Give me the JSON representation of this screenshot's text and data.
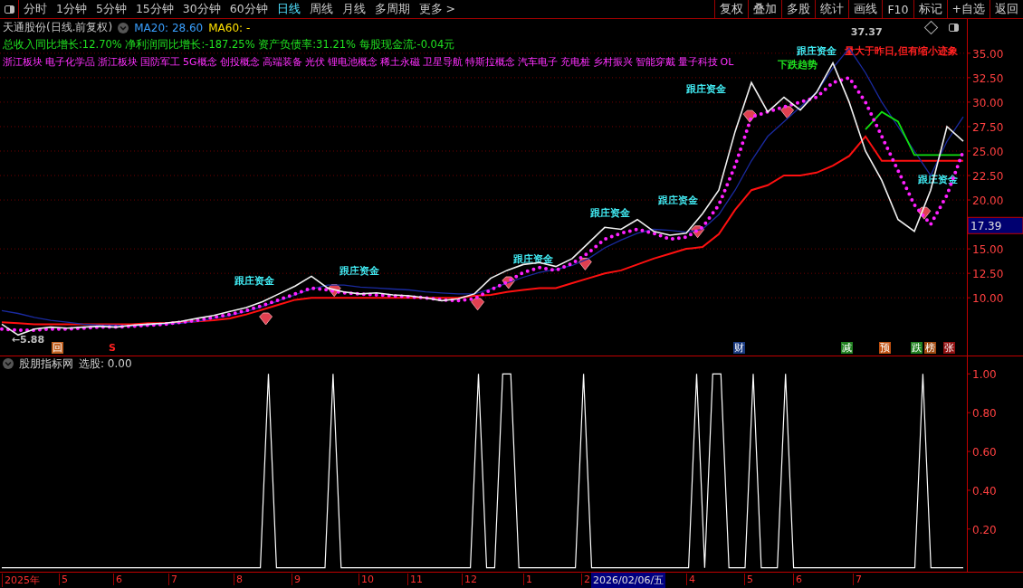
{
  "toolbar": {
    "periods": [
      {
        "label": "分时",
        "selected": false
      },
      {
        "label": "1分钟",
        "selected": false
      },
      {
        "label": "5分钟",
        "selected": false
      },
      {
        "label": "15分钟",
        "selected": false
      },
      {
        "label": "30分钟",
        "selected": false
      },
      {
        "label": "60分钟",
        "selected": false
      },
      {
        "label": "日线",
        "selected": true
      },
      {
        "label": "周线",
        "selected": false
      },
      {
        "label": "月线",
        "selected": false
      },
      {
        "label": "多周期",
        "selected": false
      },
      {
        "label": "更多 >",
        "selected": false
      }
    ],
    "buttons": [
      "复权",
      "叠加",
      "多股",
      "统计",
      "画线",
      "F10",
      "标记",
      "+自选",
      "返回"
    ]
  },
  "legend": {
    "title": "天通股份(日线.前复权)",
    "items": [
      {
        "text": "MA20: 28.60",
        "color": "#3aa0ff"
      },
      {
        "text": "MA60: -",
        "color": "#ffe000"
      }
    ]
  },
  "fundamentals": "总收入同比增长:12.70% 净利润同比增长:-187.25% 资产负债率:31.21% 每股现金流:-0.04元",
  "concepts": [
    "浙江板块",
    "电子化学品",
    "浙江板块",
    "国防军工",
    "5G概念",
    "创投概念",
    "高端装备",
    "光伏",
    "锂电池概念",
    "稀土永磁",
    "卫星导航",
    "特斯拉概念",
    "汽车电子",
    "充电桩",
    "乡村振兴",
    "智能穿戴",
    "量子科技",
    "OL"
  ],
  "main_chart": {
    "chart_data": {
      "type": "line",
      "grid": true,
      "categories": [
        null,
        null,
        null,
        null,
        null,
        null,
        null,
        null,
        null,
        null,
        null,
        null,
        null,
        null,
        null,
        null,
        null,
        null,
        null,
        null,
        null,
        null,
        null,
        null,
        null,
        null,
        null,
        null,
        null,
        null,
        null,
        null,
        null,
        null,
        null,
        null,
        null,
        null,
        null,
        null,
        null,
        null,
        null,
        null,
        null,
        null,
        null,
        null,
        null,
        null,
        null,
        null,
        null,
        null,
        null,
        null,
        null,
        null,
        null,
        null
      ],
      "ylim": [
        4.1,
        38.5
      ],
      "yticks": [
        {
          "value": 10,
          "label": "10.00"
        },
        {
          "value": 12.5,
          "label": "12.50"
        },
        {
          "value": 15,
          "label": "15.00"
        },
        {
          "value": 20,
          "label": "20.00"
        },
        {
          "value": 22.5,
          "label": "22.50"
        },
        {
          "value": 25,
          "label": "25.00"
        },
        {
          "value": 27.5,
          "label": "27.50"
        },
        {
          "value": 30,
          "label": "30.00"
        },
        {
          "value": 32.5,
          "label": "32.50"
        },
        {
          "value": 35,
          "label": "35.00"
        }
      ],
      "series": [
        {
          "color": "#ff1010",
          "values": [
            7.5,
            7.4,
            7.3,
            7.3,
            7.3,
            7.3,
            7.3,
            7.3,
            7.3,
            7.4,
            7.4,
            7.5,
            7.6,
            7.7,
            7.9,
            8.3,
            8.8,
            9.3,
            9.8,
            10.0,
            10.0,
            10.0,
            10.0,
            10.0,
            10.0,
            10.0,
            10.0,
            10.0,
            10.0,
            10.2,
            10.3,
            10.6,
            10.8,
            11.0,
            11.0,
            11.5,
            12.0,
            12.5,
            12.8,
            13.4,
            14.0,
            14.5,
            15.0,
            15.2,
            16.5,
            19.0,
            21.0,
            21.5,
            22.5,
            22.5,
            22.8,
            23.5,
            24.5,
            26.5,
            24.0,
            24.0,
            24.0,
            24.0,
            24.0,
            24.0
          ]
        },
        {
          "color": "#1a2aa0",
          "values": [
            8.7,
            8.4,
            8.0,
            7.7,
            7.5,
            7.3,
            7.2,
            7.2,
            7.1,
            7.2,
            7.3,
            7.4,
            7.6,
            7.9,
            8.2,
            8.6,
            9.1,
            9.7,
            10.3,
            10.9,
            11.3,
            11.3,
            11.1,
            11.0,
            10.9,
            10.8,
            10.6,
            10.5,
            10.4,
            10.4,
            10.9,
            11.5,
            12.1,
            12.6,
            12.9,
            13.3,
            14.0,
            15.1,
            15.9,
            16.6,
            17.0,
            16.9,
            16.7,
            17.0,
            18.5,
            21.0,
            24.0,
            26.5,
            28.0,
            29.5,
            31.0,
            33.5,
            35.5,
            33.0,
            30.0,
            27.5,
            25.0,
            22.5,
            26.0,
            28.5
          ]
        },
        {
          "color": "#10e010",
          "values": [
            null,
            null,
            null,
            null,
            null,
            null,
            null,
            null,
            null,
            null,
            null,
            null,
            null,
            null,
            null,
            null,
            null,
            null,
            null,
            null,
            null,
            null,
            null,
            null,
            null,
            null,
            null,
            null,
            null,
            null,
            null,
            null,
            null,
            null,
            null,
            null,
            null,
            null,
            null,
            null,
            null,
            null,
            null,
            null,
            null,
            null,
            null,
            null,
            null,
            null,
            null,
            null,
            null,
            27.2,
            29.0,
            28.0,
            24.6,
            24.6,
            24.6,
            24.6
          ]
        },
        {
          "color": "#ff20ff",
          "line_style": "dotted",
          "values": [
            6.8,
            6.7,
            6.7,
            6.8,
            6.8,
            6.9,
            7.0,
            7.0,
            7.1,
            7.2,
            7.3,
            7.5,
            7.7,
            8.0,
            8.3,
            8.7,
            9.2,
            9.8,
            10.4,
            11.0,
            10.8,
            10.5,
            10.4,
            10.3,
            10.2,
            10.1,
            10.0,
            9.8,
            9.7,
            9.9,
            10.8,
            11.6,
            12.6,
            13.1,
            12.8,
            13.5,
            14.6,
            16.0,
            16.6,
            17.0,
            16.6,
            16.0,
            16.2,
            17.2,
            19.5,
            23.5,
            28.5,
            29.0,
            29.5,
            30.0,
            30.5,
            32.0,
            32.5,
            30.0,
            26.5,
            23.0,
            19.5,
            17.5,
            20.5,
            25.0
          ]
        },
        {
          "color": "#f0f0f0",
          "values": [
            7.3,
            6.2,
            6.8,
            7.0,
            6.9,
            7.0,
            7.1,
            7.0,
            7.2,
            7.3,
            7.4,
            7.6,
            7.9,
            8.2,
            8.6,
            9.0,
            9.6,
            10.4,
            11.2,
            12.2,
            11.0,
            10.6,
            10.4,
            10.5,
            10.3,
            10.2,
            10.0,
            9.7,
            9.9,
            10.4,
            12.0,
            12.8,
            13.4,
            13.6,
            13.2,
            14.0,
            15.6,
            17.2,
            17.0,
            18.0,
            16.8,
            16.4,
            16.6,
            18.6,
            21.0,
            27.0,
            32.0,
            29.0,
            30.5,
            29.2,
            31.0,
            34.0,
            30.0,
            25.0,
            22.0,
            18.0,
            16.8,
            21.0,
            27.5,
            26.0
          ]
        }
      ]
    },
    "labels": [
      {
        "text": "跟庄资金",
        "color": "#40e8f0"
      },
      {
        "text": "跟庄资金",
        "color": "#40e8f0"
      },
      {
        "text": "跟庄资金",
        "color": "#40e8f0"
      },
      {
        "text": "跟庄资金",
        "color": "#40e8f0"
      },
      {
        "text": "跟庄资金",
        "color": "#40e8f0"
      },
      {
        "text": "跟庄资金",
        "color": "#40e8f0"
      },
      {
        "text": "跟庄资金",
        "color": "#40e8f0"
      },
      {
        "text": "跟庄资金",
        "color": "#40e8f0"
      },
      {
        "text": "下跌趋势",
        "color": "#20e020"
      },
      {
        "text": "37.37",
        "color": "#c0c0c0"
      },
      {
        "text": "量大于昨日,但有缩小迹象",
        "color": "#ff2020"
      },
      {
        "text": "←5.88",
        "color": "#c0c0c0"
      }
    ],
    "last_price": "17.39",
    "events": [
      {
        "text": "回",
        "color": "#c06020"
      },
      {
        "text": "S",
        "color": "#ff2020"
      },
      {
        "text": "财",
        "color": "#1a3a80"
      },
      {
        "text": "减",
        "color": "#208020"
      },
      {
        "text": "预",
        "color": "#c05010"
      },
      {
        "text": "跌",
        "color": "#208020"
      },
      {
        "text": "榜",
        "color": "#a04a10"
      },
      {
        "text": "张",
        "color": "#901010"
      }
    ]
  },
  "indicator": {
    "title": "股朋指标网",
    "reading": "选股: 0.00",
    "chart_data": {
      "type": "line",
      "categories": [
        null,
        null,
        null,
        null,
        null,
        null,
        null,
        null,
        null,
        null,
        null,
        null,
        null,
        null,
        null,
        null,
        null,
        null,
        null,
        null,
        null,
        null,
        null,
        null,
        null,
        null,
        null,
        null,
        null,
        null,
        null,
        null,
        null,
        null,
        null,
        null,
        null,
        null,
        null,
        null,
        null,
        null,
        null,
        null,
        null,
        null,
        null,
        null,
        null,
        null,
        null,
        null,
        null,
        null,
        null,
        null,
        null,
        null,
        null,
        null,
        null,
        null,
        null,
        null,
        null,
        null,
        null,
        null,
        null,
        null,
        null,
        null,
        null,
        null,
        null,
        null,
        null,
        null,
        null,
        null,
        null,
        null,
        null,
        null,
        null,
        null,
        null,
        null,
        null,
        null,
        null,
        null,
        null,
        null,
        null,
        null,
        null,
        null,
        null,
        null,
        null,
        null,
        null,
        null,
        null,
        null,
        null,
        null,
        null,
        null,
        null,
        null,
        null,
        null,
        null,
        null,
        null,
        null,
        null,
        null
      ],
      "ylim": [
        -0.02,
        1.09
      ],
      "yticks": [
        {
          "value": 0.2,
          "label": "0.20"
        },
        {
          "value": 0.4,
          "label": "0.40"
        },
        {
          "value": 0.6,
          "label": "0.60"
        },
        {
          "value": 0.8,
          "label": "0.80"
        },
        {
          "value": 1,
          "label": "1.00"
        }
      ],
      "series": [
        {
          "color": "#ffffff",
          "values": [
            0,
            0,
            0,
            0,
            0,
            0,
            0,
            0,
            0,
            0,
            0,
            0,
            0,
            0,
            0,
            0,
            0,
            0,
            0,
            0,
            0,
            0,
            0,
            0,
            0,
            0,
            0,
            0,
            0,
            0,
            0,
            0,
            0,
            1,
            0,
            0,
            0,
            0,
            0,
            0,
            0,
            1,
            0,
            0,
            0,
            0,
            0,
            0,
            0,
            0,
            0,
            0,
            0,
            0,
            0,
            0,
            0,
            0,
            0,
            1,
            0,
            0,
            1,
            1,
            0,
            0,
            0,
            0,
            0,
            0,
            0,
            0,
            1,
            0,
            0,
            0,
            0,
            0,
            0,
            0,
            0,
            0,
            0,
            0,
            0,
            0,
            1,
            0,
            1,
            1,
            0,
            0,
            0,
            1,
            0,
            0,
            0,
            1,
            0,
            0,
            0,
            0,
            0,
            0,
            0,
            0,
            0,
            0,
            0,
            0,
            0,
            0,
            0,
            0,
            1,
            0,
            0,
            0,
            0,
            0
          ]
        }
      ]
    }
  },
  "date_axis": {
    "labels": [
      "2025年",
      "5",
      "6",
      "7",
      "8",
      "9",
      "10",
      "11",
      "12",
      "1",
      "2",
      "4",
      "5",
      "6",
      "7"
    ],
    "cursor": "2026/02/06/五"
  }
}
